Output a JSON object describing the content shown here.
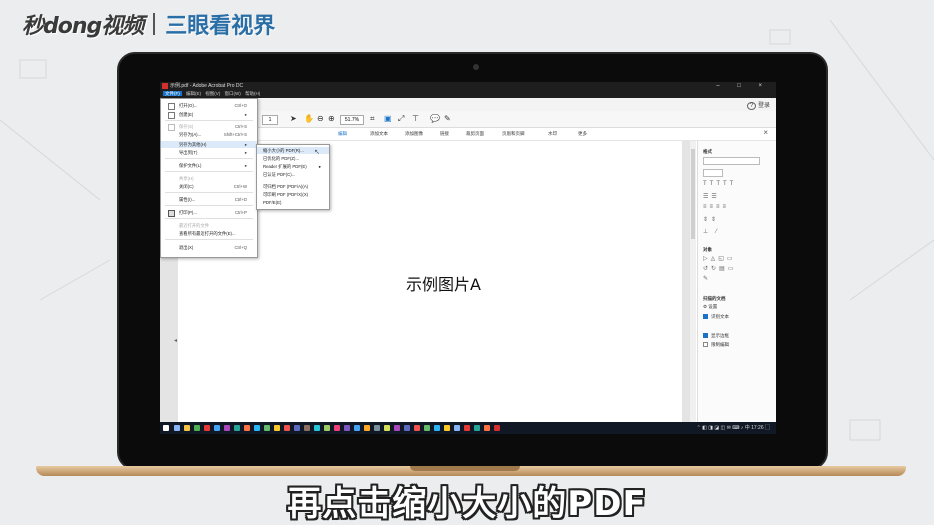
{
  "watermark": {
    "logo": "秒dong视频",
    "brand": "三眼看视界"
  },
  "window": {
    "title": "示例.pdf - Adobe Acrobat Pro DC",
    "controls": "–  □  ×"
  },
  "menubar": [
    "文件(F)",
    "编辑(E)",
    "视图(V)",
    "窗口(W)",
    "帮助(H)"
  ],
  "tabbar": {
    "help": "?",
    "login": "登录"
  },
  "toolbar": {
    "page_value": "1",
    "zoom_value": "51.7%"
  },
  "editbar": [
    "编辑",
    "添加文本",
    "添加图像",
    "链接",
    "裁剪页面",
    "页眉和页脚",
    "水印",
    "更多"
  ],
  "file_menu": {
    "items": [
      {
        "label": "打开(O)...",
        "shortcut": "Ctrl+O"
      },
      {
        "label": "创建(E)",
        "shortcut": "▸"
      },
      {
        "label": "保存(S)",
        "shortcut": "Ctrl+S",
        "disabled": true
      },
      {
        "label": "另存为(A)...",
        "shortcut": "Shift+Ctrl+S"
      },
      {
        "label": "另存为其他(H)",
        "shortcut": "▸",
        "highlight": true
      },
      {
        "label": "导出到(T)",
        "shortcut": "▸"
      },
      {
        "label": "保护文件(L)",
        "shortcut": "▸"
      },
      {
        "label": "共享(H)",
        "shortcut": "",
        "disabled": true
      },
      {
        "label": "关闭(C)",
        "shortcut": "Ctrl+W"
      },
      {
        "label": "属性(I)...",
        "shortcut": "Ctrl+D"
      },
      {
        "label": "打印(P)...",
        "shortcut": "Ctrl+P"
      },
      {
        "label": "最近打开的文件",
        "shortcut": "",
        "disabled": true
      },
      {
        "label": "查看所有最近打开的文件(E)...",
        "shortcut": ""
      },
      {
        "label": "退出(X)",
        "shortcut": "Ctrl+Q"
      }
    ]
  },
  "submenu": {
    "items": [
      {
        "label": "缩小大小的 PDF(R)...",
        "highlight": true,
        "arrow": ""
      },
      {
        "label": "已优化的 PDF(Z)...",
        "arrow": ""
      },
      {
        "label": "Reader 扩展的 PDF(E)",
        "arrow": "▸"
      },
      {
        "label": "已认证 PDF(C)...",
        "arrow": ""
      },
      {
        "label": "可归档 PDF (PDF/A)(A)",
        "arrow": ""
      },
      {
        "label": "可印刷 PDF (PDF/X)(X)",
        "arrow": ""
      },
      {
        "label": "PDF/E(E)",
        "arrow": ""
      }
    ]
  },
  "document": {
    "page_text": "示例图片A"
  },
  "right_panel": {
    "format_title": "格式",
    "objects_title": "对象",
    "scanned_title": "扫描的文档",
    "settings": "设置",
    "recognize_text": "识别文本",
    "show_bbox": "显示边框",
    "restrict_edit": "限制编辑"
  },
  "taskbar": {
    "clock": "17:26"
  },
  "subtitle": "再点击缩小大小的PDF"
}
